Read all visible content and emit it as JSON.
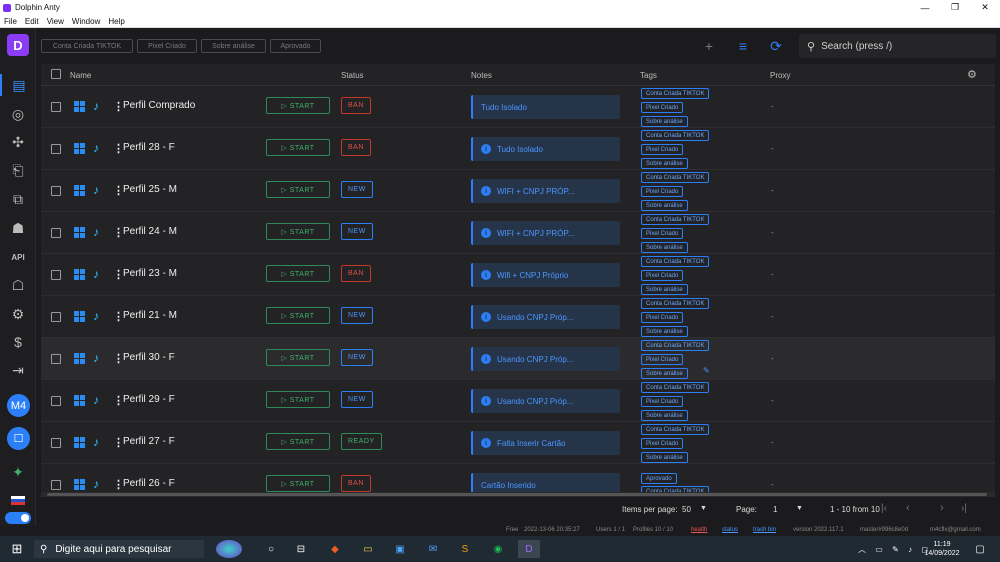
{
  "window": {
    "title": "Dolphin Anty",
    "minimize": "—",
    "maximize": "❐",
    "close": "✕"
  },
  "menu": [
    "File",
    "Edit",
    "View",
    "Window",
    "Help"
  ],
  "sidebar": {
    "logo": "D",
    "avatar": "M4",
    "active_color": "#2d7ff9"
  },
  "filters": [
    "Conta Criada TIKTOK",
    "Pixel Criado",
    "Sobre análise",
    "Aprovado"
  ],
  "search": {
    "placeholder": "Search (press /)"
  },
  "columns": {
    "name": "Name",
    "status": "Status",
    "notes": "Notes",
    "tags": "Tags",
    "proxy": "Proxy"
  },
  "start_label": "▷ START",
  "profiles": [
    {
      "name": "Perfil Comprado",
      "status": "BAN",
      "note": "Tudo Isolado",
      "note_icon": false,
      "tags": [
        "Conta Criada TIKTOK",
        "Pixel Criado",
        "Sobre análise"
      ],
      "proxy": "-"
    },
    {
      "name": "Perfil 28 - F",
      "status": "BAN",
      "note": "Tudo Isolado",
      "note_icon": true,
      "tags": [
        "Conta Criada TIKTOK",
        "Pixel Criado",
        "Sobre análise"
      ],
      "proxy": "-"
    },
    {
      "name": "Perfil 25 - M",
      "status": "NEW",
      "note": "WIFI + CNPJ PRÓP...",
      "note_icon": true,
      "tags": [
        "Conta Criada TIKTOK",
        "Pixel Criado",
        "Sobre análise"
      ],
      "proxy": "-"
    },
    {
      "name": "Perfil 24 - M",
      "status": "NEW",
      "note": "WIFI + CNPJ PRÓP...",
      "note_icon": true,
      "tags": [
        "Conta Criada TIKTOK",
        "Pixel Criado",
        "Sobre análise"
      ],
      "proxy": "-"
    },
    {
      "name": "Perfil 23 - M",
      "status": "BAN",
      "note": "Wifi + CNPJ Próprio",
      "note_icon": true,
      "tags": [
        "Conta Criada TIKTOK",
        "Pixel Criado",
        "Sobre análise"
      ],
      "proxy": "-"
    },
    {
      "name": "Perfil 21 - M",
      "status": "NEW",
      "note": "Usando CNPJ Próp...",
      "note_icon": true,
      "tags": [
        "Conta Criada TIKTOK",
        "Pixel Criado",
        "Sobre análise"
      ],
      "proxy": "-"
    },
    {
      "name": "Perfil 30 - F",
      "status": "NEW",
      "note": "Usando CNPJ Próp...",
      "note_icon": true,
      "tags": [
        "Conta Criada TIKTOK",
        "Pixel Criado",
        "Sobre análise"
      ],
      "proxy": "-",
      "highlight": true
    },
    {
      "name": "Perfil 29 - F",
      "status": "NEW",
      "note": "Usando CNPJ Próp...",
      "note_icon": true,
      "tags": [
        "Conta Criada TIKTOK",
        "Pixel Criado",
        "Sobre análise"
      ],
      "proxy": "-"
    },
    {
      "name": "Perfil 27 - F",
      "status": "READY",
      "note": "Falta Inserir Cartão",
      "note_icon": true,
      "tags": [
        "Conta Criada TIKTOK",
        "Pixel Criado",
        "Sobre análise"
      ],
      "proxy": "-"
    },
    {
      "name": "Perfil 26 - F",
      "status": "BAN",
      "note": "Cartão Inserido",
      "note_icon": false,
      "tags": [
        "Aprovado",
        "Conta Criada TIKTOK"
      ],
      "proxy": "-"
    }
  ],
  "pagination": {
    "items_label": "Items per page:",
    "items_value": "50",
    "page_label": "Page:",
    "page_value": "1",
    "range": "1 - 10 from 10"
  },
  "statusbar": {
    "free": "Free",
    "date": "2022-13-06 20:35:27",
    "users": "Users 1 / 1",
    "profiles": "Profiles 10 / 10",
    "health": "health",
    "status": "status",
    "trash": "trash bin",
    "version": "version 2022.117.1",
    "master": "master#996c8e0d",
    "user": "m4cflx@gmail.com"
  },
  "taskbar": {
    "search_placeholder": "Digite aqui para pesquisar",
    "time": "11:19",
    "date": "14/09/2022"
  }
}
